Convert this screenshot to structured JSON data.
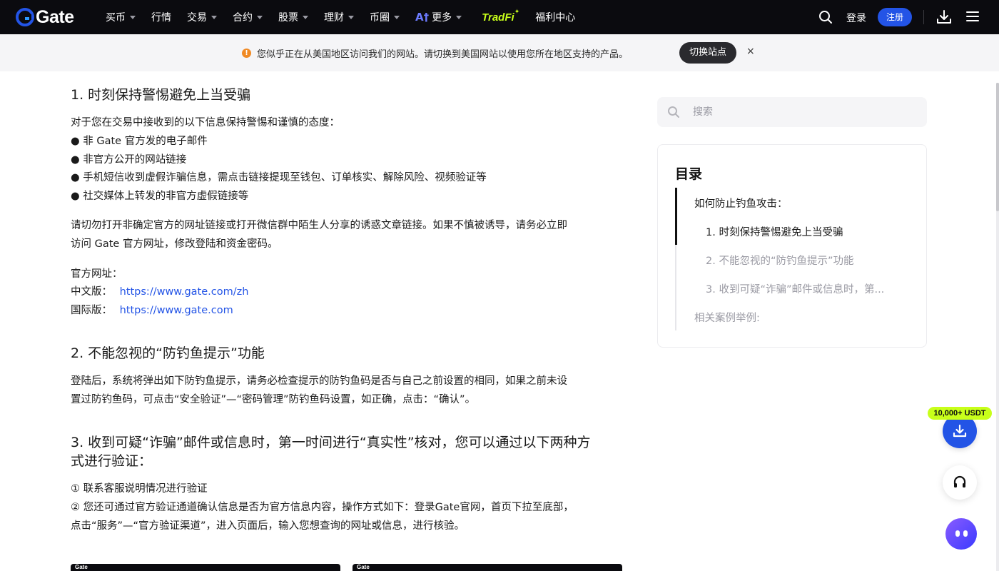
{
  "nav": {
    "logo_text": "Gate",
    "items": [
      {
        "label": "买币",
        "caret": true
      },
      {
        "label": "行情",
        "caret": false
      },
      {
        "label": "交易",
        "caret": true
      },
      {
        "label": "合约",
        "caret": true
      },
      {
        "label": "股票",
        "caret": true
      },
      {
        "label": "理财",
        "caret": true
      },
      {
        "label": "币圈",
        "caret": true
      },
      {
        "label": "更多",
        "caret": true,
        "ai_prefix": "A†"
      }
    ],
    "tradfi": "TradFi",
    "welfare": "福利中心",
    "login": "登录",
    "register": "注册"
  },
  "banner": {
    "text": "您似乎正在从美国地区访问我们的网站。请切换到美国网站以使用您所在地区支持的产品。",
    "button": "切换站点",
    "close": "×"
  },
  "article": {
    "h1": "1. 时刻保持警惕避免上当受骗",
    "p1_lead": "对于您在交易中接收到的以下信息保持警惕和谨慎的态度：",
    "bullets": [
      "● 非 Gate 官方发的电子邮件",
      "● 非官方公开的网站链接",
      "● 手机短信收到虚假诈骗信息，需点击链接提现至钱包、订单核实、解除风险、视频验证等",
      "● 社交媒体上转发的非官方虚假链接等"
    ],
    "p2_line1": "请切勿打开非确定官方的网址链接或打开微信群中陌生人分享的诱惑文章链接。如果不慎被诱导，请务必立即",
    "p2_line2": "访问 Gate 官方网址，修改登陆和资金密码。",
    "official_label": "官方网址：",
    "cn_label": "中文版：",
    "cn_url": "https://www.gate.com/zh",
    "intl_label": "国际版：",
    "intl_url": "https://www.gate.com",
    "h2": "2. 不能忽视的“防钓鱼提示”功能",
    "p3_line1": "登陆后，系统将弹出如下防钓鱼提示，请务必检查提示的防钓鱼码是否与自己之前设置的相同，如果之前未设",
    "p3_line2": "置过防钓鱼码，可点击“安全验证”—“密码管理”防钓鱼码设置，如正确，点击：“确认”。",
    "h3_line1": "3. 收到可疑“诈骗”邮件或信息时，第一时间进行“真实性”核对，您可以通过以下两种方",
    "h3_line2": "式进行验证：",
    "s1": "① 联系客服说明情况进行验证",
    "s2_line1": "② 您还可通过官方验证通道确认信息是否为官方信息内容，操作方式如下：登录Gate官网，首页下拉至底部，",
    "s2_line2": "点击“服务”—“官方验证渠道”，进入页面后，输入您想查询的网址或信息，进行核验。",
    "shot_logo": "Gate"
  },
  "sidebar": {
    "search_placeholder": "搜索",
    "toc_title": "目录",
    "toc": [
      {
        "label": "如何防止钓鱼攻击：",
        "active": true
      },
      {
        "label": "1. 时刻保持警惕避免上当受骗",
        "active": true
      },
      {
        "label": "2. 不能忽视的“防钓鱼提示”功能",
        "active": false
      },
      {
        "label": "3. 收到可疑“诈骗”邮件或信息时，第...",
        "active": false
      },
      {
        "label": "相关案例举例:",
        "active": false
      }
    ]
  },
  "floating": {
    "promo": "10,000+ USDT"
  },
  "colors": {
    "brand_blue": "#2354e6",
    "nav_bg": "#0b0b0f",
    "link": "#2354e6",
    "promo_green": "#c8ff1a"
  }
}
